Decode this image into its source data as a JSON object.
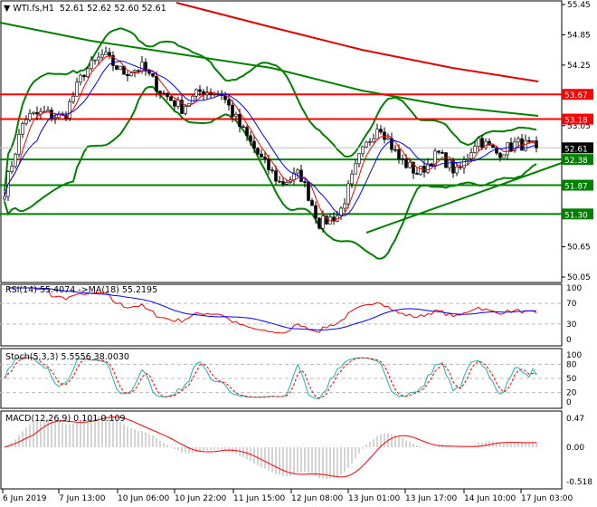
{
  "header": {
    "symbol": "WTI.fs,H1",
    "ohlc": "52.61 52.62 52.60 52.61"
  },
  "price_axis": {
    "ticks": [
      55.45,
      54.85,
      54.25,
      53.05,
      50.65,
      50.05
    ],
    "range": [
      50.05,
      55.45
    ]
  },
  "levels": [
    {
      "price": 53.67,
      "label": "53.67",
      "color": "#ff0000"
    },
    {
      "price": 53.18,
      "label": "53.18",
      "color": "#ff0000"
    },
    {
      "price": 52.61,
      "label": "52.61",
      "color": "#000000",
      "line": "#c0c0c0"
    },
    {
      "price": 52.38,
      "label": "52.38",
      "color": "#008000"
    },
    {
      "price": 51.87,
      "label": "51.87",
      "color": "#008000"
    },
    {
      "price": 51.3,
      "label": "51.30",
      "color": "#008000"
    }
  ],
  "price_anchors": [
    51.77,
    53.2,
    53.3,
    53.2,
    54.1,
    54.45,
    54.1,
    54.2,
    53.7,
    53.4,
    53.75,
    53.7,
    53.0,
    52.4,
    51.9,
    52.1,
    51.1,
    51.3,
    52.4,
    53.1,
    52.4,
    52.1,
    52.5,
    52.1,
    52.8,
    52.5,
    52.7,
    52.61
  ],
  "rsi": {
    "label": "RSI(14) 55.4074  ->MA(18) 55.2195",
    "ticks": [
      "100",
      "70",
      "30",
      "0"
    ]
  },
  "stoch": {
    "label": "Stoch(5,3,3) 5.5556 38.0030",
    "ticks": [
      "100",
      "80",
      "50",
      "20",
      "0"
    ]
  },
  "macd": {
    "label": "MACD(12,26,9) 0.101 0.109",
    "ticks": [
      "0.47",
      "0.00",
      "-0.518"
    ]
  },
  "time_axis": [
    "6 Jun 2019",
    "7 Jun 13:00",
    "10 Jun 06:00",
    "10 Jun 22:00",
    "11 Jun 15:00",
    "12 Jun 08:00",
    "13 Jun 01:00",
    "13 Jun 17:00",
    "14 Jun 10:00",
    "17 Jun 03:00"
  ]
}
